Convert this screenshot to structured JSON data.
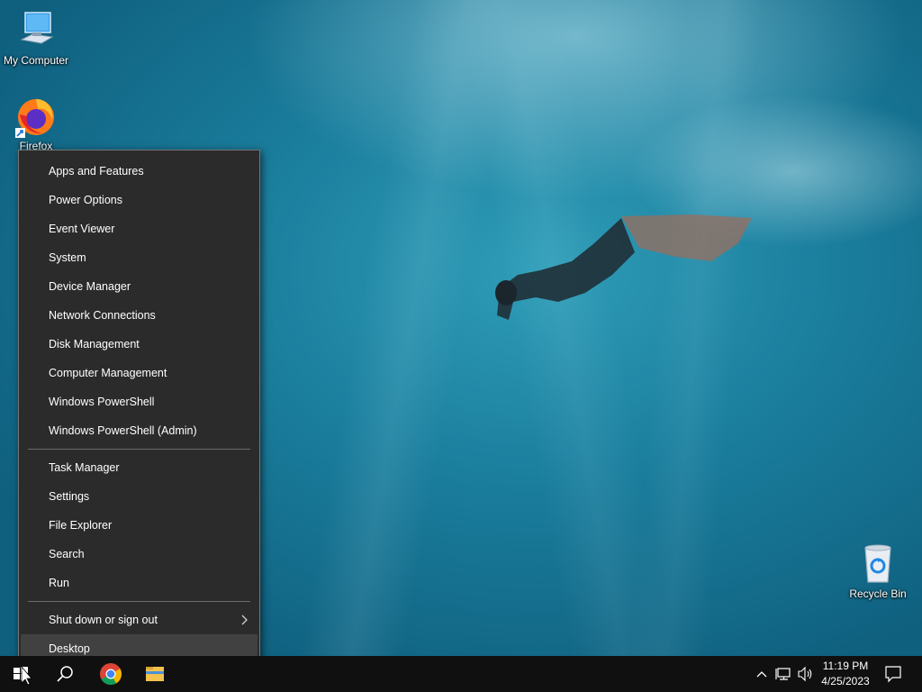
{
  "desktop": {
    "icons": [
      {
        "label": "My Computer",
        "icon": "my-computer-icon"
      },
      {
        "label": "Firefox",
        "icon": "firefox-icon"
      },
      {
        "label": "Recycle Bin",
        "icon": "recycle-bin-icon"
      }
    ]
  },
  "menu": {
    "group1": [
      "Apps and Features",
      "Power Options",
      "Event Viewer",
      "System",
      "Device Manager",
      "Network Connections",
      "Disk Management",
      "Computer Management",
      "Windows PowerShell",
      "Windows PowerShell (Admin)"
    ],
    "group2": [
      "Task Manager",
      "Settings",
      "File Explorer",
      "Search",
      "Run"
    ],
    "group3": [
      "Shut down or sign out",
      "Desktop"
    ]
  },
  "taskbar": {
    "time": "11:19 PM",
    "date": "4/25/2023"
  },
  "colors": {
    "menu_bg": "#2b2b2b",
    "menu_hover": "#414141",
    "taskbar_bg": "#101010"
  }
}
